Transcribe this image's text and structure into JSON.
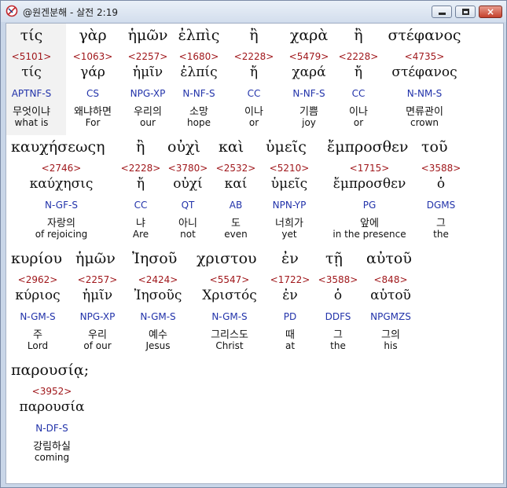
{
  "window": {
    "title": "@원겐분해 - 살전 2:19"
  },
  "controls": {
    "minimize": "minimize",
    "maximize": "maximize",
    "close": "×"
  },
  "rows": [
    {
      "words": [
        {
          "greek": "τίς",
          "strong": "<5101>",
          "lemma": "τίς",
          "morph": "APTNF-S",
          "kor": "무엇이냐",
          "eng": "what is"
        },
        {
          "greek": "γὰρ",
          "strong": "<1063>",
          "lemma": "γάρ",
          "morph": "CS",
          "kor": "왜냐하면",
          "eng": "For"
        },
        {
          "greek": "ἡμῶν",
          "strong": "<2257>",
          "lemma": "ἡμῖν",
          "morph": "NPG-XP",
          "kor": "우리의",
          "eng": "our"
        },
        {
          "greek": "ἐλπὶς",
          "strong": "<1680>",
          "lemma": "ἐλπίς",
          "morph": "N-NF-S",
          "kor": "소망",
          "eng": "hope"
        },
        {
          "greek": "ἢ",
          "strong": "<2228>",
          "lemma": "ἤ",
          "morph": "CC",
          "kor": "이나",
          "eng": "or"
        },
        {
          "greek": "χαρὰ",
          "strong": "<5479>",
          "lemma": "χαρά",
          "morph": "N-NF-S",
          "kor": "기쁨",
          "eng": "joy"
        },
        {
          "greek": "ἢ",
          "strong": "<2228>",
          "lemma": "ἤ",
          "morph": "CC",
          "kor": "이나",
          "eng": "or"
        },
        {
          "greek": "στέφανος",
          "strong": "<4735>",
          "lemma": "στέφανος",
          "morph": "N-NM-S",
          "kor": "면류관이",
          "eng": "crown"
        }
      ]
    },
    {
      "words": [
        {
          "greek": "καυχήσεωςη",
          "strong": "<2746>",
          "lemma": "καύχησις",
          "morph": "N-GF-S",
          "kor": "자랑의",
          "eng": "of rejoicing"
        },
        {
          "greek": "ἢ",
          "strong": "<2228>",
          "lemma": "ἤ",
          "morph": "CC",
          "kor": "냐",
          "eng": "Are"
        },
        {
          "greek": "οὐχὶ",
          "strong": "<3780>",
          "lemma": "οὐχί",
          "morph": "QT",
          "kor": "아니",
          "eng": "not"
        },
        {
          "greek": "καὶ",
          "strong": "<2532>",
          "lemma": "καί",
          "morph": "AB",
          "kor": "도",
          "eng": "even"
        },
        {
          "greek": "ὑμεῖς",
          "strong": "<5210>",
          "lemma": "ὑμεῖς",
          "morph": "NPN-YP",
          "kor": "너희가",
          "eng": "yet"
        },
        {
          "greek": "ἔμπροσθεν",
          "strong": "<1715>",
          "lemma": "ἔμπροσθεν",
          "morph": "PG",
          "kor": "앞에",
          "eng": "in the presence"
        },
        {
          "greek": "τοῦ",
          "strong": "<3588>",
          "lemma": "ὁ",
          "morph": "DGMS",
          "kor": "그",
          "eng": "the"
        }
      ]
    },
    {
      "words": [
        {
          "greek": "κυρίου",
          "strong": "<2962>",
          "lemma": "κύριος",
          "morph": "N-GM-S",
          "kor": "주",
          "eng": "Lord"
        },
        {
          "greek": "ἡμῶν",
          "strong": "<2257>",
          "lemma": "ἡμῖν",
          "morph": "NPG-XP",
          "kor": "우리",
          "eng": "of our"
        },
        {
          "greek": "Ἰησοῦ",
          "strong": "<2424>",
          "lemma": "Ἰησοῦς",
          "morph": "N-GM-S",
          "kor": "예수",
          "eng": "Jesus"
        },
        {
          "greek": "χριστου",
          "strong": "<5547>",
          "lemma": "Χριστός",
          "morph": "N-GM-S",
          "kor": "그리스도",
          "eng": "Christ"
        },
        {
          "greek": "ἐν",
          "strong": "<1722>",
          "lemma": "ἐν",
          "morph": "PD",
          "kor": "때",
          "eng": "at"
        },
        {
          "greek": "τῇ",
          "strong": "<3588>",
          "lemma": "ὁ",
          "morph": "DDFS",
          "kor": "그",
          "eng": "the"
        },
        {
          "greek": "αὐτοῦ",
          "strong": "<848>",
          "lemma": "αὑτοῦ",
          "morph": "NPGMZS",
          "kor": "그의",
          "eng": "his"
        }
      ]
    },
    {
      "words": [
        {
          "greek": "παρουσίᾳ;",
          "strong": "<3952>",
          "lemma": "παρουσία",
          "morph": "N-DF-S",
          "kor": "강림하실",
          "eng": "coming"
        }
      ]
    }
  ]
}
